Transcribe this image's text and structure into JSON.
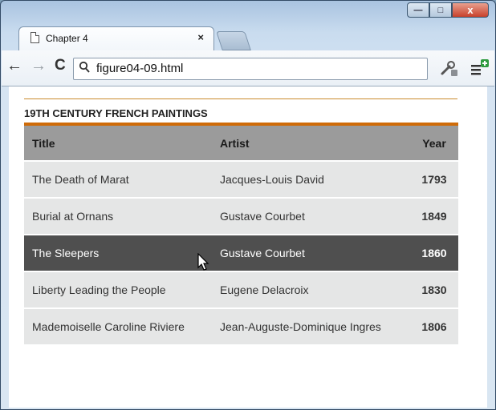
{
  "window": {
    "tab_title": "Chapter 4",
    "tab_close": "×",
    "controls": {
      "minimize": "—",
      "maximize": "□",
      "close": "x"
    }
  },
  "toolbar": {
    "back": "←",
    "forward": "→",
    "reload": "C",
    "address_value": "figure04-09.html"
  },
  "page": {
    "caption": "19TH CENTURY FRENCH PAINTINGS",
    "table": {
      "headers": {
        "title": "Title",
        "artist": "Artist",
        "year": "Year"
      },
      "rows": [
        {
          "title": "The Death of Marat",
          "artist": "Jacques-Louis David",
          "year": "1793"
        },
        {
          "title": "Burial at Ornans",
          "artist": "Gustave Courbet",
          "year": "1849"
        },
        {
          "title": "The Sleepers",
          "artist": "Gustave Courbet",
          "year": "1860"
        },
        {
          "title": "Liberty Leading the People",
          "artist": "Eugene Delacroix",
          "year": "1830"
        },
        {
          "title": "Mademoiselle Caroline Riviere",
          "artist": "Jean-Auguste-Dominique Ingres",
          "year": "1806"
        }
      ]
    }
  },
  "colors": {
    "caption_rule": "#c98a2b",
    "table_top_rule": "#cf6b08",
    "header_bg": "#9b9b9b",
    "row_bg": "#e5e6e6",
    "hover_row_bg": "#4f4f4f"
  },
  "icons": [
    "page-icon",
    "search-icon",
    "wrench-icon",
    "chrome-menu-icon",
    "mouse-cursor-icon"
  ]
}
